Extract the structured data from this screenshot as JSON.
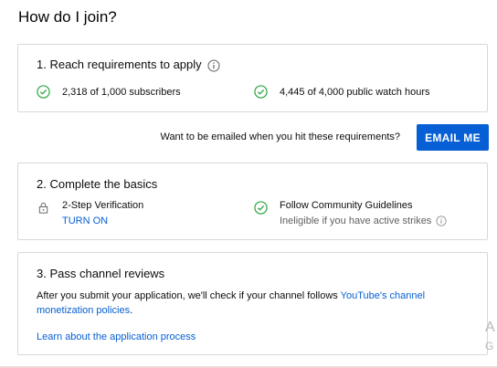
{
  "heading": "How do I join?",
  "step1": {
    "title": "1. Reach requirements to apply",
    "requirements": [
      {
        "text": "2,318 of 1,000 subscribers",
        "icon": "check-circle-icon",
        "status": "met"
      },
      {
        "text": "4,445 of 4,000 public watch hours",
        "icon": "check-circle-icon",
        "status": "met"
      }
    ]
  },
  "email": {
    "prompt": "Want to be emailed when you hit these requirements?",
    "button_label": "EMAIL ME"
  },
  "step2": {
    "title": "2. Complete the basics",
    "two_step": {
      "label": "2-Step Verification",
      "action": "TURN ON",
      "icon": "lock-icon"
    },
    "guidelines": {
      "label": "Follow Community Guidelines",
      "note": "Ineligible if you have active strikes",
      "icon": "check-circle-icon"
    }
  },
  "step3": {
    "title": "3. Pass channel reviews",
    "description_prefix": "After you submit your application, we'll check if your channel follows ",
    "description_link": "YouTube's channel monetization policies",
    "description_suffix": ".",
    "learn_link": "Learn about the application process"
  },
  "watermark": {
    "line1": "A",
    "line2": "G"
  },
  "colors": {
    "accent": "#065fd4",
    "check": "#2ba640",
    "border": "#d8d8d8"
  }
}
